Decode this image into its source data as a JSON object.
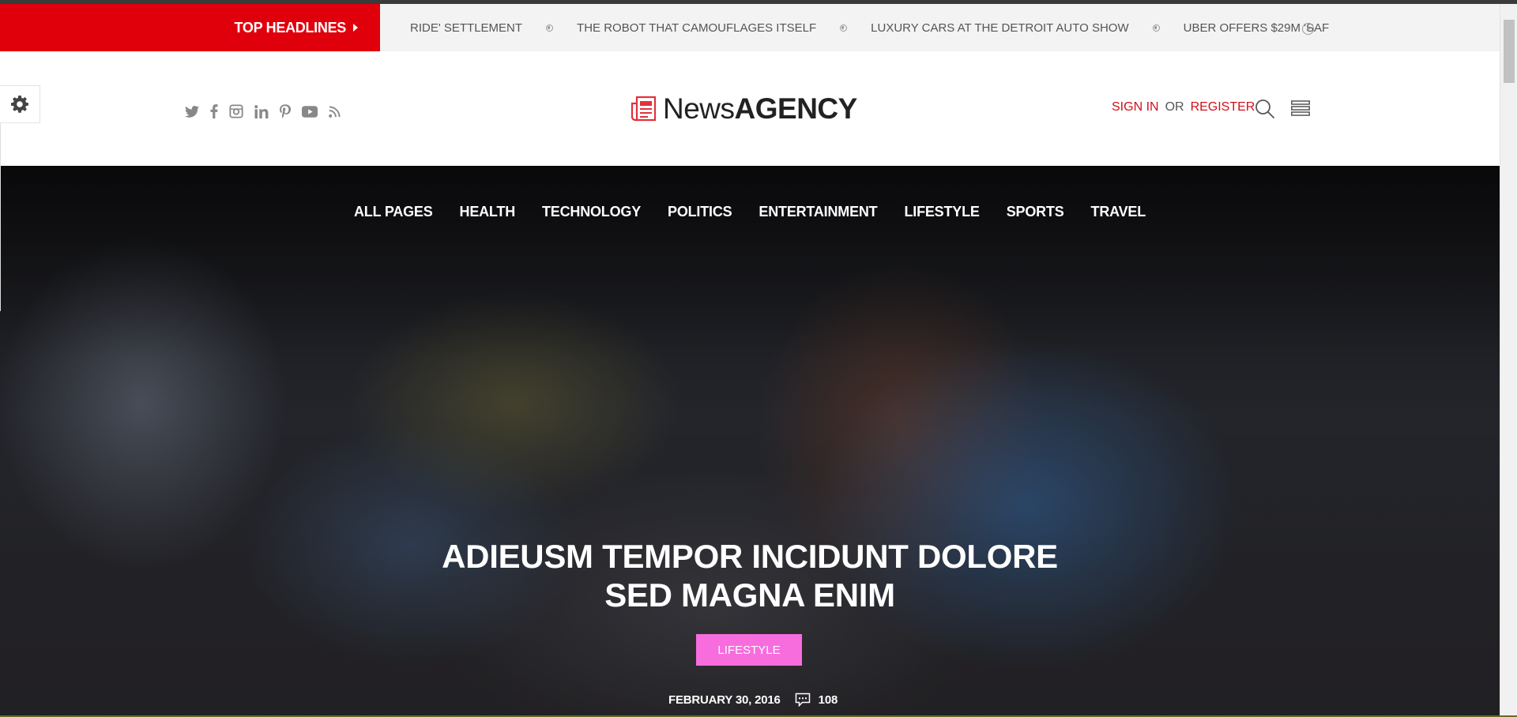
{
  "colors": {
    "accent_red": "#e0000c",
    "link_red": "#d20f1a",
    "category_pink": "#f76ddd"
  },
  "headlines": {
    "label": "TOP HEADLINES",
    "items": [
      "RIDE' SETTLEMENT",
      "THE ROBOT THAT CAMOUFLAGES ITSELF",
      "LUXURY CARS AT THE DETROIT AUTO SHOW",
      "UBER OFFERS $29M 'SAF"
    ]
  },
  "header": {
    "socials": [
      "twitter-icon",
      "facebook-icon",
      "instagram-icon",
      "linkedin-icon",
      "pinterest-icon",
      "youtube-icon",
      "rss-icon"
    ],
    "logo": {
      "part1": "News",
      "part2": "AGENCY"
    },
    "auth": {
      "sign_in": "SIGN IN",
      "or": "OR",
      "register": "REGISTER"
    }
  },
  "nav": [
    "ALL PAGES",
    "HEALTH",
    "TECHNOLOGY",
    "POLITICS",
    "ENTERTAINMENT",
    "LIFESTYLE",
    "SPORTS",
    "TRAVEL"
  ],
  "hero": {
    "title_line1": "ADIEUSM TEMPOR INCIDUNT DOLORE",
    "title_line2": "SED MAGNA ENIM",
    "category": "LIFESTYLE",
    "date": "FEBRUARY 30, 2016",
    "comments": "108"
  }
}
